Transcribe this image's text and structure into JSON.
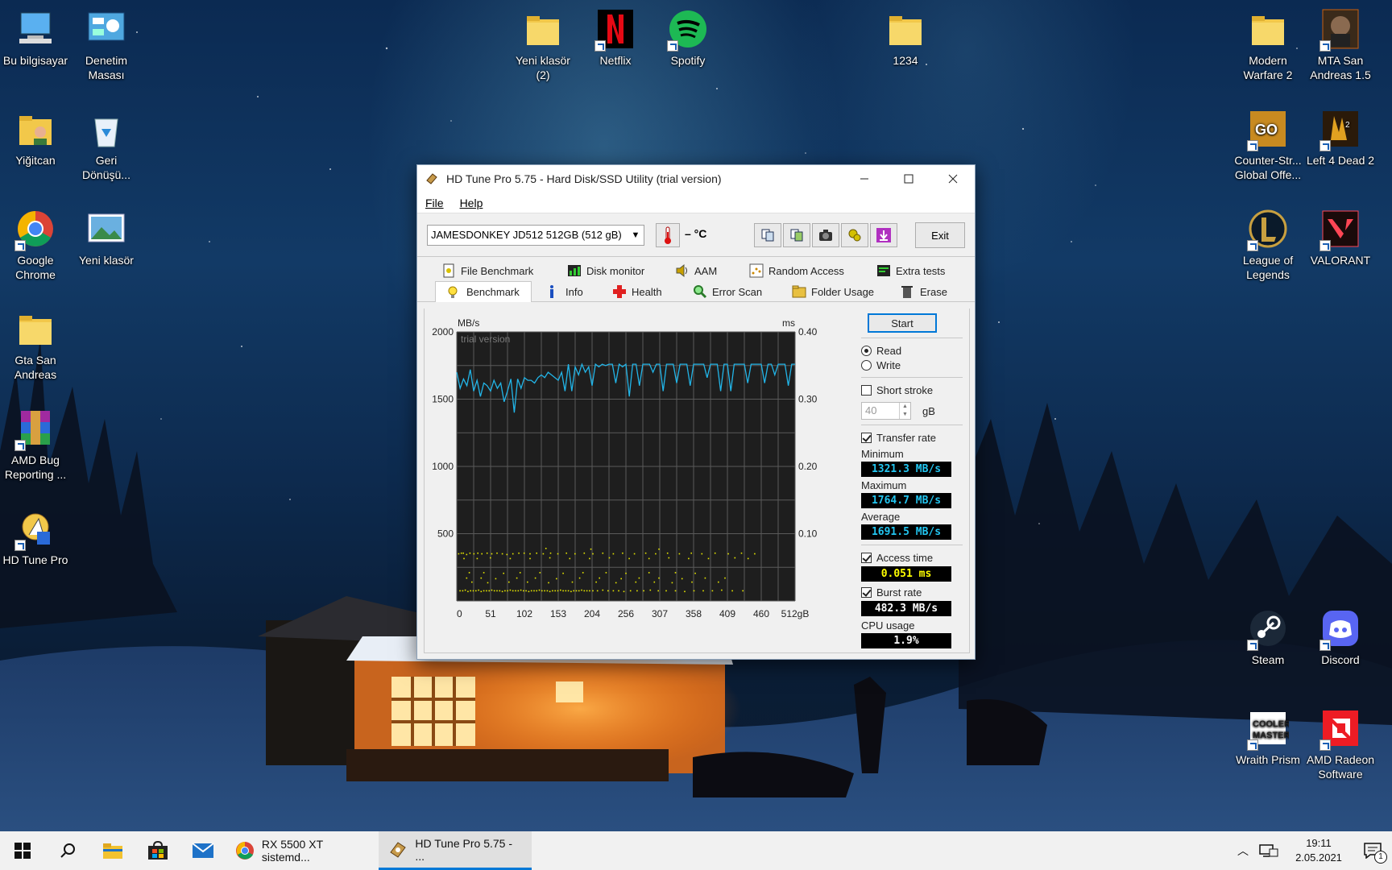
{
  "desktop": {
    "icons": [
      {
        "label": "Bu bilgisayar",
        "icon": "computer-icon"
      },
      {
        "label": "Denetim Masası",
        "icon": "control-panel-icon"
      },
      {
        "label": "Yiğitcan",
        "icon": "user-folder-icon"
      },
      {
        "label": "Geri Dönüşü...",
        "icon": "recycle-bin-icon"
      },
      {
        "label": "Google Chrome",
        "icon": "chrome-icon"
      },
      {
        "label": "Yeni klasör",
        "icon": "image-folder-icon"
      },
      {
        "label": "Gta San Andreas",
        "icon": "folder-icon"
      },
      {
        "label": "AMD Bug Reporting ...",
        "icon": "winrar-icon"
      },
      {
        "label": "HD Tune Pro",
        "icon": "hdtune-icon"
      },
      {
        "label": "Yeni klasör (2)",
        "icon": "folder-icon"
      },
      {
        "label": "Netflix",
        "icon": "netflix-icon"
      },
      {
        "label": "Spotify",
        "icon": "spotify-icon"
      },
      {
        "label": "1234",
        "icon": "folder-icon"
      },
      {
        "label": "Modern Warfare 2",
        "icon": "folder-icon"
      },
      {
        "label": "MTA San Andreas 1.5",
        "icon": "mta-icon"
      },
      {
        "label": "Counter-Str... Global Offe...",
        "icon": "csgo-icon"
      },
      {
        "label": "Left 4 Dead 2",
        "icon": "l4d2-icon"
      },
      {
        "label": "League of Legends",
        "icon": "lol-icon"
      },
      {
        "label": "VALORANT",
        "icon": "valorant-icon"
      },
      {
        "label": "Steam",
        "icon": "steam-icon"
      },
      {
        "label": "Discord",
        "icon": "discord-icon"
      },
      {
        "label": "Wraith Prism",
        "icon": "coolermaster-icon"
      },
      {
        "label": "AMD Radeon Software",
        "icon": "amd-icon"
      }
    ]
  },
  "window": {
    "title": "HD Tune Pro 5.75 - Hard Disk/SSD Utility (trial version)",
    "menu": {
      "file": "File",
      "help": "Help"
    },
    "drive": "JAMESDONKEY JD512 512GB (512 gB)",
    "temperature": "– °C",
    "exit_label": "Exit",
    "tabs_row1": [
      "File Benchmark",
      "Disk monitor",
      "AAM",
      "Random Access",
      "Extra tests"
    ],
    "tabs_row2": [
      "Benchmark",
      "Info",
      "Health",
      "Error Scan",
      "Folder Usage",
      "Erase"
    ],
    "active_tab": "Benchmark",
    "start_label": "Start",
    "read_label": "Read",
    "write_label": "Write",
    "short_stroke_label": "Short stroke",
    "short_stroke_value": "40",
    "short_stroke_unit": "gB",
    "transfer_rate_label": "Transfer rate",
    "minimum_label": "Minimum",
    "minimum_value": "1321.3 MB/s",
    "maximum_label": "Maximum",
    "maximum_value": "1764.7 MB/s",
    "average_label": "Average",
    "average_value": "1691.5 MB/s",
    "access_time_label": "Access time",
    "access_time_value": "0.051 ms",
    "burst_rate_label": "Burst rate",
    "burst_rate_value": "482.3 MB/s",
    "cpu_usage_label": "CPU usage",
    "cpu_usage_value": "1.9%",
    "colors": {
      "transfer_line": "#22b5e8",
      "access_points": "#e6e600",
      "plot_bg": "#202020"
    }
  },
  "chart_data": {
    "type": "line",
    "watermark": "trial version",
    "ylabel_left": "MB/s",
    "ylabel_right": "ms",
    "y_left_ticks": [
      "2000",
      "1500",
      "1000",
      "500"
    ],
    "y_right_ticks": [
      "0.40",
      "0.30",
      "0.20",
      "0.10"
    ],
    "x_ticks": [
      "0",
      "51",
      "102",
      "153",
      "204",
      "256",
      "307",
      "358",
      "409",
      "460",
      "512gB"
    ],
    "ylim_left": [
      0,
      2000
    ],
    "ylim_right": [
      0,
      0.4
    ],
    "xlim": [
      0,
      512
    ],
    "series": [
      {
        "values": [
          1700,
          1580,
          1650,
          1600,
          1720,
          1560,
          1640,
          1520,
          1620,
          1600,
          1560,
          1640,
          1580,
          1620,
          1480,
          1560,
          1650,
          1400,
          1650,
          1580,
          1660,
          1640,
          1640,
          1620,
          1660,
          1680,
          1660,
          1700,
          1680,
          1660,
          1640,
          1700,
          1560,
          1760,
          1560,
          1740,
          1680,
          1760,
          1700,
          1740,
          1600,
          1760,
          1740,
          1760,
          1750,
          1760,
          1760,
          1620,
          1760,
          1740,
          1760,
          1520,
          1760,
          1760,
          1600,
          1760,
          1760,
          1760,
          1700,
          1760,
          1760,
          1560,
          1760,
          1760,
          1760,
          1620,
          1760,
          1760,
          1760,
          1600,
          1760,
          1760,
          1760,
          1760,
          1660,
          1760,
          1760,
          1760,
          1560,
          1760,
          1760,
          1560,
          1760,
          1760,
          1760,
          1760,
          1620,
          1760,
          1760,
          1760,
          1760,
          1620,
          1760,
          1760,
          1680,
          1760,
          1760,
          1760,
          1600,
          1760,
          1760
        ]
      },
      {
        "points": [
          [
            2,
            0.071
          ],
          [
            6,
            0.072
          ],
          [
            9,
            0.072
          ],
          [
            14,
            0.07
          ],
          [
            19,
            0.072
          ],
          [
            25,
            0.071
          ],
          [
            31,
            0.072
          ],
          [
            37,
            0.071
          ],
          [
            45,
            0.072
          ],
          [
            52,
            0.071
          ],
          [
            60,
            0.072
          ],
          [
            68,
            0.071
          ],
          [
            75,
            0.07
          ],
          [
            84,
            0.071
          ],
          [
            93,
            0.072
          ],
          [
            101,
            0.072
          ],
          [
            110,
            0.071
          ],
          [
            120,
            0.072
          ],
          [
            130,
            0.071
          ],
          [
            141,
            0.072
          ],
          [
            152,
            0.071
          ],
          [
            165,
            0.072
          ],
          [
            178,
            0.071
          ],
          [
            192,
            0.072
          ],
          [
            205,
            0.071
          ],
          [
            220,
            0.072
          ],
          [
            236,
            0.071
          ],
          [
            250,
            0.072
          ],
          [
            268,
            0.071
          ],
          [
            285,
            0.072
          ],
          [
            300,
            0.071
          ],
          [
            318,
            0.072
          ],
          [
            336,
            0.071
          ],
          [
            354,
            0.072
          ],
          [
            370,
            0.071
          ],
          [
            390,
            0.072
          ],
          [
            410,
            0.071
          ],
          [
            430,
            0.072
          ],
          [
            450,
            0.071
          ],
          [
            4,
            0.016
          ],
          [
            8,
            0.016
          ],
          [
            12,
            0.017
          ],
          [
            16,
            0.015
          ],
          [
            20,
            0.016
          ],
          [
            24,
            0.016
          ],
          [
            28,
            0.016
          ],
          [
            32,
            0.017
          ],
          [
            36,
            0.015
          ],
          [
            40,
            0.016
          ],
          [
            44,
            0.016
          ],
          [
            48,
            0.016
          ],
          [
            52,
            0.017
          ],
          [
            56,
            0.016
          ],
          [
            60,
            0.016
          ],
          [
            64,
            0.016
          ],
          [
            68,
            0.015
          ],
          [
            72,
            0.016
          ],
          [
            76,
            0.016
          ],
          [
            80,
            0.017
          ],
          [
            84,
            0.016
          ],
          [
            88,
            0.016
          ],
          [
            92,
            0.016
          ],
          [
            96,
            0.017
          ],
          [
            100,
            0.016
          ],
          [
            104,
            0.016
          ],
          [
            108,
            0.015
          ],
          [
            112,
            0.016
          ],
          [
            116,
            0.016
          ],
          [
            120,
            0.016
          ],
          [
            124,
            0.017
          ],
          [
            128,
            0.016
          ],
          [
            132,
            0.016
          ],
          [
            136,
            0.016
          ],
          [
            140,
            0.015
          ],
          [
            144,
            0.016
          ],
          [
            148,
            0.016
          ],
          [
            152,
            0.016
          ],
          [
            156,
            0.017
          ],
          [
            160,
            0.016
          ],
          [
            164,
            0.016
          ],
          [
            168,
            0.016
          ],
          [
            172,
            0.015
          ],
          [
            176,
            0.016
          ],
          [
            180,
            0.016
          ],
          [
            184,
            0.016
          ],
          [
            188,
            0.017
          ],
          [
            192,
            0.016
          ],
          [
            196,
            0.016
          ],
          [
            200,
            0.016
          ],
          [
            205,
            0.016
          ],
          [
            212,
            0.016
          ],
          [
            220,
            0.017
          ],
          [
            228,
            0.016
          ],
          [
            236,
            0.016
          ],
          [
            244,
            0.016
          ],
          [
            252,
            0.015
          ],
          [
            262,
            0.016
          ],
          [
            272,
            0.016
          ],
          [
            282,
            0.016
          ],
          [
            292,
            0.017
          ],
          [
            304,
            0.016
          ],
          [
            316,
            0.016
          ],
          [
            330,
            0.016
          ],
          [
            344,
            0.015
          ],
          [
            358,
            0.016
          ],
          [
            372,
            0.016
          ],
          [
            386,
            0.016
          ],
          [
            400,
            0.017
          ],
          [
            416,
            0.016
          ],
          [
            432,
            0.016
          ],
          [
            10,
            0.064
          ],
          [
            30,
            0.064
          ],
          [
            50,
            0.065
          ],
          [
            80,
            0.064
          ],
          [
            110,
            0.064
          ],
          [
            140,
            0.065
          ],
          [
            170,
            0.064
          ],
          [
            200,
            0.064
          ],
          [
            230,
            0.065
          ],
          [
            260,
            0.064
          ],
          [
            290,
            0.064
          ],
          [
            320,
            0.065
          ],
          [
            350,
            0.064
          ],
          [
            380,
            0.064
          ],
          [
            420,
            0.065
          ],
          [
            440,
            0.064
          ],
          [
            18,
            0.043
          ],
          [
            40,
            0.043
          ],
          [
            70,
            0.042
          ],
          [
            95,
            0.043
          ],
          [
            125,
            0.043
          ],
          [
            160,
            0.042
          ],
          [
            190,
            0.043
          ],
          [
            225,
            0.043
          ],
          [
            255,
            0.042
          ],
          [
            290,
            0.043
          ],
          [
            330,
            0.043
          ],
          [
            360,
            0.042
          ],
          [
            14,
            0.035
          ],
          [
            36,
            0.035
          ],
          [
            58,
            0.034
          ],
          [
            90,
            0.035
          ],
          [
            118,
            0.035
          ],
          [
            150,
            0.034
          ],
          [
            185,
            0.035
          ],
          [
            215,
            0.035
          ],
          [
            248,
            0.034
          ],
          [
            275,
            0.035
          ],
          [
            305,
            0.035
          ],
          [
            340,
            0.034
          ],
          [
            375,
            0.035
          ],
          [
            405,
            0.035
          ],
          [
            22,
            0.029
          ],
          [
            46,
            0.028
          ],
          [
            78,
            0.029
          ],
          [
            106,
            0.029
          ],
          [
            138,
            0.028
          ],
          [
            174,
            0.029
          ],
          [
            210,
            0.029
          ],
          [
            240,
            0.028
          ],
          [
            270,
            0.029
          ],
          [
            298,
            0.029
          ],
          [
            325,
            0.028
          ],
          [
            355,
            0.029
          ],
          [
            395,
            0.029
          ],
          [
            134,
            0.079
          ],
          [
            202,
            0.078
          ],
          [
            305,
            0.078
          ]
        ]
      }
    ]
  },
  "taskbar": {
    "start": "windows-icon",
    "search": "search-icon",
    "apps": [
      {
        "label": "RX 5500 XT sistemd...",
        "icon": "chrome-icon"
      },
      {
        "label": "HD Tune Pro 5.75 - ...",
        "icon": "hdtune-icon"
      }
    ],
    "time": "19:11",
    "date": "2.05.2021",
    "notification_count": "1"
  }
}
